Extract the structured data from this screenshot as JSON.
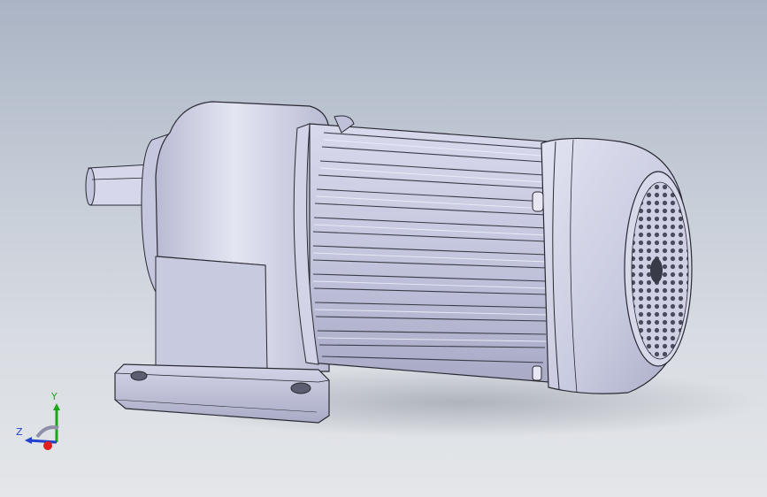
{
  "scene": {
    "background_top": "#aab4c4",
    "background_bottom": "#e4e6e9",
    "model_color": "#c9cbe0"
  },
  "triad": {
    "x_label": "",
    "y_label": "Y",
    "z_label": "Z",
    "colors": {
      "x": "#e02020",
      "y": "#1aa81a",
      "z": "#2040d0"
    }
  }
}
